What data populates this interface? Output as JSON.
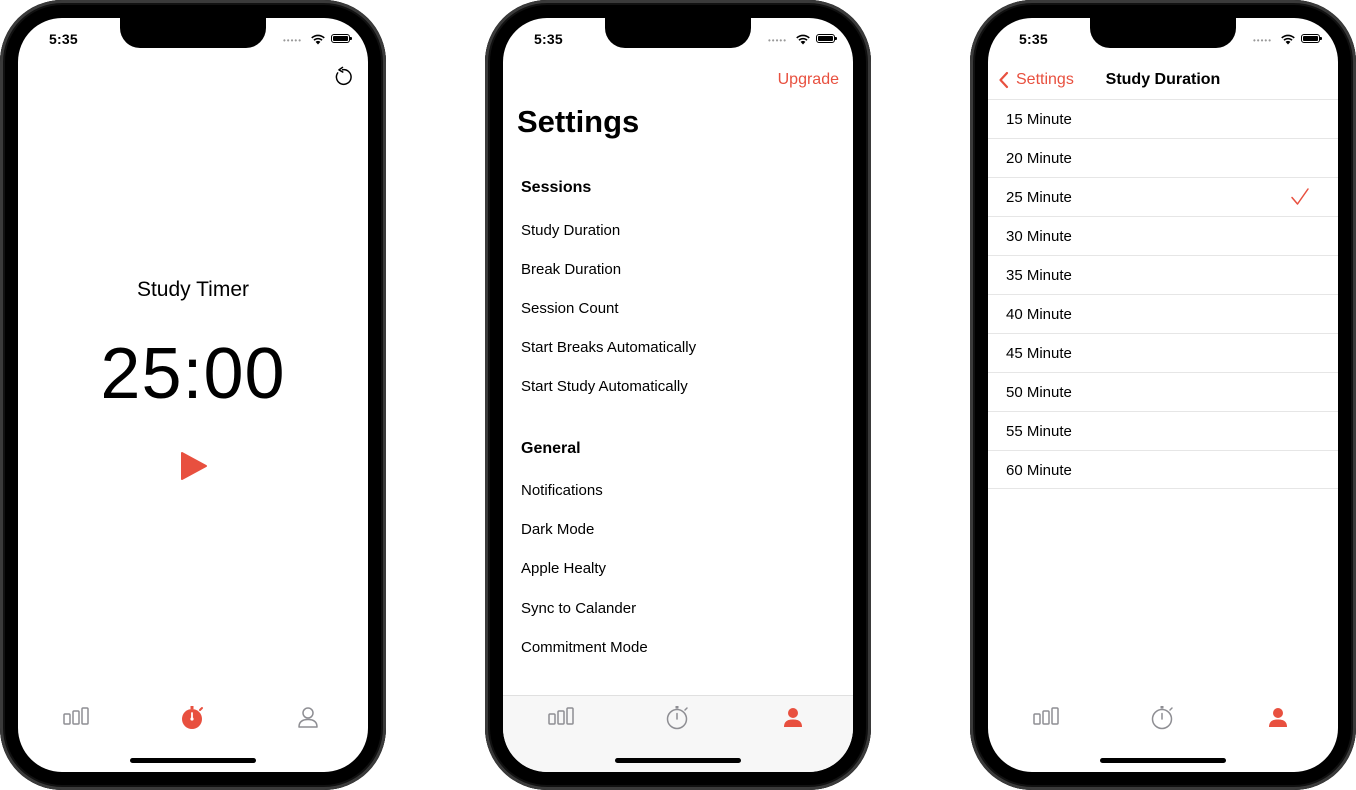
{
  "status_bar": {
    "time": "5:35",
    "signal_dots": "•••••"
  },
  "colors": {
    "accent": "#e8503f",
    "inactive_tab": "#8e8e93",
    "separator": "#e6e6e6"
  },
  "phone1": {
    "title": "Study Timer",
    "timer": "25:00",
    "icons": {
      "reset": "reset-icon",
      "play": "play-icon"
    },
    "tabs": [
      {
        "icon": "stats-icon",
        "active": false
      },
      {
        "icon": "timer-icon",
        "active": true
      },
      {
        "icon": "profile-icon",
        "active": false
      }
    ]
  },
  "phone2": {
    "upgrade_label": "Upgrade",
    "title": "Settings",
    "sections": [
      {
        "header": "Sessions",
        "items": [
          "Study Duration",
          "Break Duration",
          "Session Count",
          "Start Breaks Automatically",
          "Start Study Automatically"
        ]
      },
      {
        "header": "General",
        "items": [
          "Notifications",
          "Dark Mode",
          "Apple Healty",
          "Sync to Calander",
          "Commitment Mode"
        ]
      }
    ],
    "tabs": [
      {
        "icon": "stats-icon",
        "active": false
      },
      {
        "icon": "timer-icon",
        "active": false
      },
      {
        "icon": "profile-icon",
        "active": true
      }
    ]
  },
  "phone3": {
    "back_label": "Settings",
    "title": "Study Duration",
    "options": [
      "15 Minute",
      "20 Minute",
      "25 Minute",
      "30 Minute",
      "35 Minute",
      "40 Minute",
      "45 Minute",
      "50 Minute",
      "55 Minute",
      "60 Minute"
    ],
    "selected_option": "25 Minute",
    "tabs": [
      {
        "icon": "stats-icon",
        "active": false
      },
      {
        "icon": "timer-icon",
        "active": false
      },
      {
        "icon": "profile-icon",
        "active": true
      }
    ]
  }
}
